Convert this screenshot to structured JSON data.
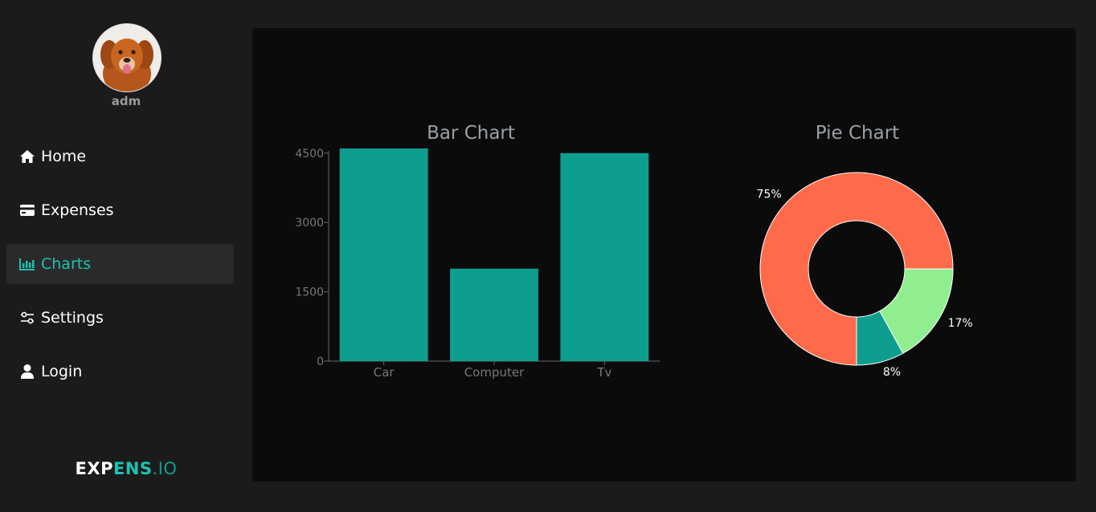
{
  "user": {
    "name": "adm"
  },
  "nav": {
    "items": [
      {
        "label": "Home",
        "icon": "home-icon"
      },
      {
        "label": "Expenses",
        "icon": "credit-card-icon"
      },
      {
        "label": "Charts",
        "icon": "bar-chart-icon",
        "active": true
      },
      {
        "label": "Settings",
        "icon": "sliders-icon"
      },
      {
        "label": "Login",
        "icon": "user-icon"
      }
    ]
  },
  "brand": {
    "part1": "EXP",
    "part2": "ENS",
    "part3": ".IO"
  },
  "colors": {
    "accent": "#19c4b0",
    "bar": "#0e9e8f",
    "pie": [
      "#ff6b4a",
      "#0e9e8f",
      "#90ee90"
    ]
  },
  "chart_data": [
    {
      "type": "bar",
      "title": "Bar Chart",
      "categories": [
        "Car",
        "Computer",
        "Tv"
      ],
      "values": [
        4600,
        2000,
        4500
      ],
      "yticks": [
        0,
        1500,
        3000,
        4500
      ],
      "ylim": [
        0,
        4600
      ]
    },
    {
      "type": "pie",
      "title": "Pie Chart",
      "donut": true,
      "slices": [
        {
          "label": "75%",
          "value": 75,
          "color": "#ff6b4a"
        },
        {
          "label": "8%",
          "value": 8,
          "color": "#0e9e8f"
        },
        {
          "label": "17%",
          "value": 17,
          "color": "#90ee90"
        }
      ]
    }
  ]
}
